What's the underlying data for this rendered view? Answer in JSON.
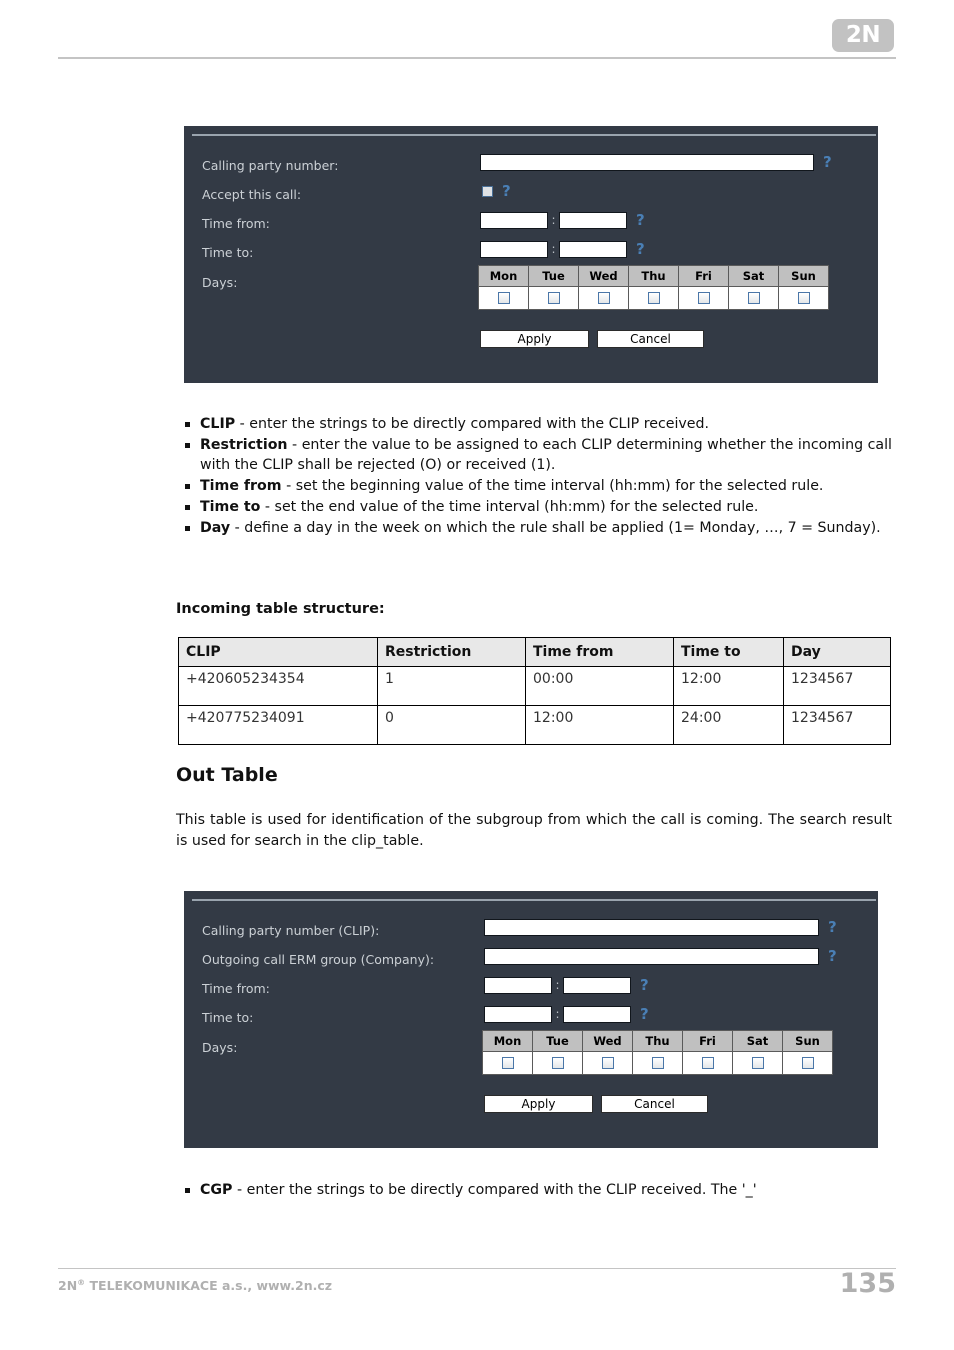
{
  "header": {
    "logo_text": "2N"
  },
  "panel_incoming": {
    "rows": {
      "calling_party_label": "Calling party number:",
      "accept_call_label": "Accept this call:",
      "time_from_label": "Time from:",
      "time_to_label": "Time to:",
      "days_label": "Days:"
    },
    "values": {
      "calling_party_number": "",
      "accept_this_call": false,
      "time_from_hh": "",
      "time_from_mm": "",
      "time_to_hh": "",
      "time_to_mm": ""
    },
    "time_separator": ":",
    "help_icon": "?",
    "days": [
      {
        "label": "Mon",
        "checked": false
      },
      {
        "label": "Tue",
        "checked": false
      },
      {
        "label": "Wed",
        "checked": false
      },
      {
        "label": "Thu",
        "checked": false
      },
      {
        "label": "Fri",
        "checked": false
      },
      {
        "label": "Sat",
        "checked": false
      },
      {
        "label": "Sun",
        "checked": false
      }
    ],
    "buttons": {
      "apply": "Apply",
      "cancel": "Cancel"
    }
  },
  "bullets_incoming": [
    {
      "term": "CLIP",
      "text": " - enter the strings to be directly compared with the CLIP received."
    },
    {
      "term": "Restriction",
      "text": " - enter the value to be assigned to each CLIP determining whether the incoming call with the CLIP shall be rejected (O) or received (1)."
    },
    {
      "term": "Time from",
      "text": " - set the beginning value of the time interval (hh:mm) for the selected rule."
    },
    {
      "term": "Time to",
      "text": " - set the end value of the time interval (hh:mm) for the selected rule."
    },
    {
      "term": "Day",
      "text": " - define a day in the week on which the rule shall be applied (1= Monday, …, 7 = Sunday)."
    }
  ],
  "incoming_table": {
    "caption": "Incoming table structure:",
    "headers": [
      "CLIP",
      "Restriction",
      "Time from",
      "Time to",
      "Day"
    ],
    "rows": [
      [
        "+420605234354",
        "1",
        "00:00",
        "12:00",
        "1234567"
      ],
      [
        "+420775234091",
        "0",
        "12:00",
        "24:00",
        "1234567"
      ]
    ]
  },
  "out_table_section": {
    "heading": "Out Table",
    "paragraph": "This table is used for identification of the subgroup from which the call is coming. The search result is used for search in the clip_table."
  },
  "panel_out": {
    "rows": {
      "clip_label": "Calling party number (CLIP):",
      "erm_group_label": "Outgoing call ERM group (Company):",
      "time_from_label": "Time from:",
      "time_to_label": "Time to:",
      "days_label": "Days:"
    },
    "values": {
      "clip": "",
      "erm_group": "",
      "time_from_hh": "",
      "time_from_mm": "",
      "time_to_hh": "",
      "time_to_mm": ""
    },
    "time_separator": ":",
    "help_icon": "?",
    "days": [
      {
        "label": "Mon",
        "checked": false
      },
      {
        "label": "Tue",
        "checked": false
      },
      {
        "label": "Wed",
        "checked": false
      },
      {
        "label": "Thu",
        "checked": false
      },
      {
        "label": "Fri",
        "checked": false
      },
      {
        "label": "Sat",
        "checked": false
      },
      {
        "label": "Sun",
        "checked": false
      }
    ],
    "buttons": {
      "apply": "Apply",
      "cancel": "Cancel"
    }
  },
  "bullets_out": [
    {
      "term": "CGP",
      "text": " - enter the strings to be directly compared with the CLIP received. The '_'"
    }
  ],
  "footer": {
    "company": "2N",
    "registered": "®",
    "company_rest": " TELEKOMUNIKACE a.s., www.2n.cz",
    "page_number": "135"
  },
  "colors": {
    "panel_bg": "#333a45",
    "panel_label": "#ccd1d6",
    "help_blue": "#4a7fb5",
    "day_header_bg": "#c0c0c0",
    "table_header_bg": "#e8e8e8",
    "footer_gray": "#b0b0b0",
    "logo_gray": "#c2c2c2"
  }
}
